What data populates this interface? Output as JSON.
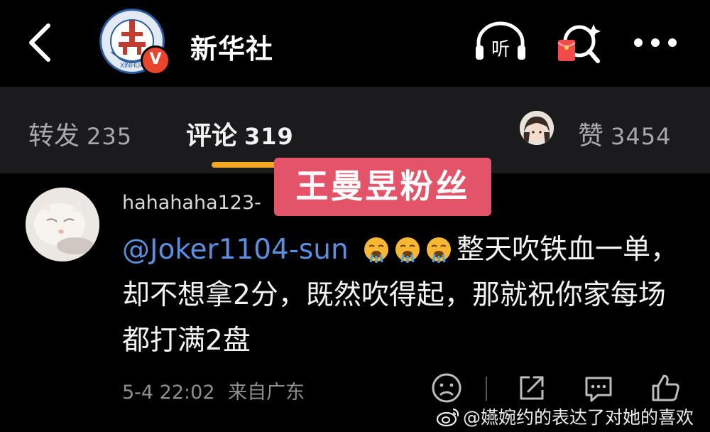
{
  "header": {
    "account_name": "新华社",
    "logo_text": "XINHUA",
    "verified_badge": "V",
    "icons": [
      "back-icon",
      "listen-icon",
      "red-packet-search-icon",
      "more-icon"
    ],
    "listen_label": "听"
  },
  "tabs": {
    "repost": {
      "label": "转发",
      "count": "235"
    },
    "comment": {
      "label": "评论",
      "count": "319"
    },
    "like": {
      "label": "赞",
      "count": "3454"
    }
  },
  "overlay_label": "王曼昱粉丝",
  "comment": {
    "username": "hahahaha123-",
    "mention": "@Joker1104-sun",
    "emoji": [
      "face-exhaling-icon",
      "face-exhaling-icon",
      "face-exhaling-icon"
    ],
    "body": "整天吹铁血一单，却不想拿2分，既然吹得起，那就祝你家每场都打满2盘",
    "timestamp": "5-4 22:02",
    "location": "来自广东",
    "actions": [
      "dislike-icon",
      "share-icon",
      "reply-icon",
      "like-icon"
    ]
  },
  "watermark": "@嬿婉约的表达了对她的喜欢",
  "colors": {
    "accent": "#f5a623",
    "overlay": "#e35469",
    "mention": "#5b8fe0",
    "badge": "#e8452c"
  }
}
